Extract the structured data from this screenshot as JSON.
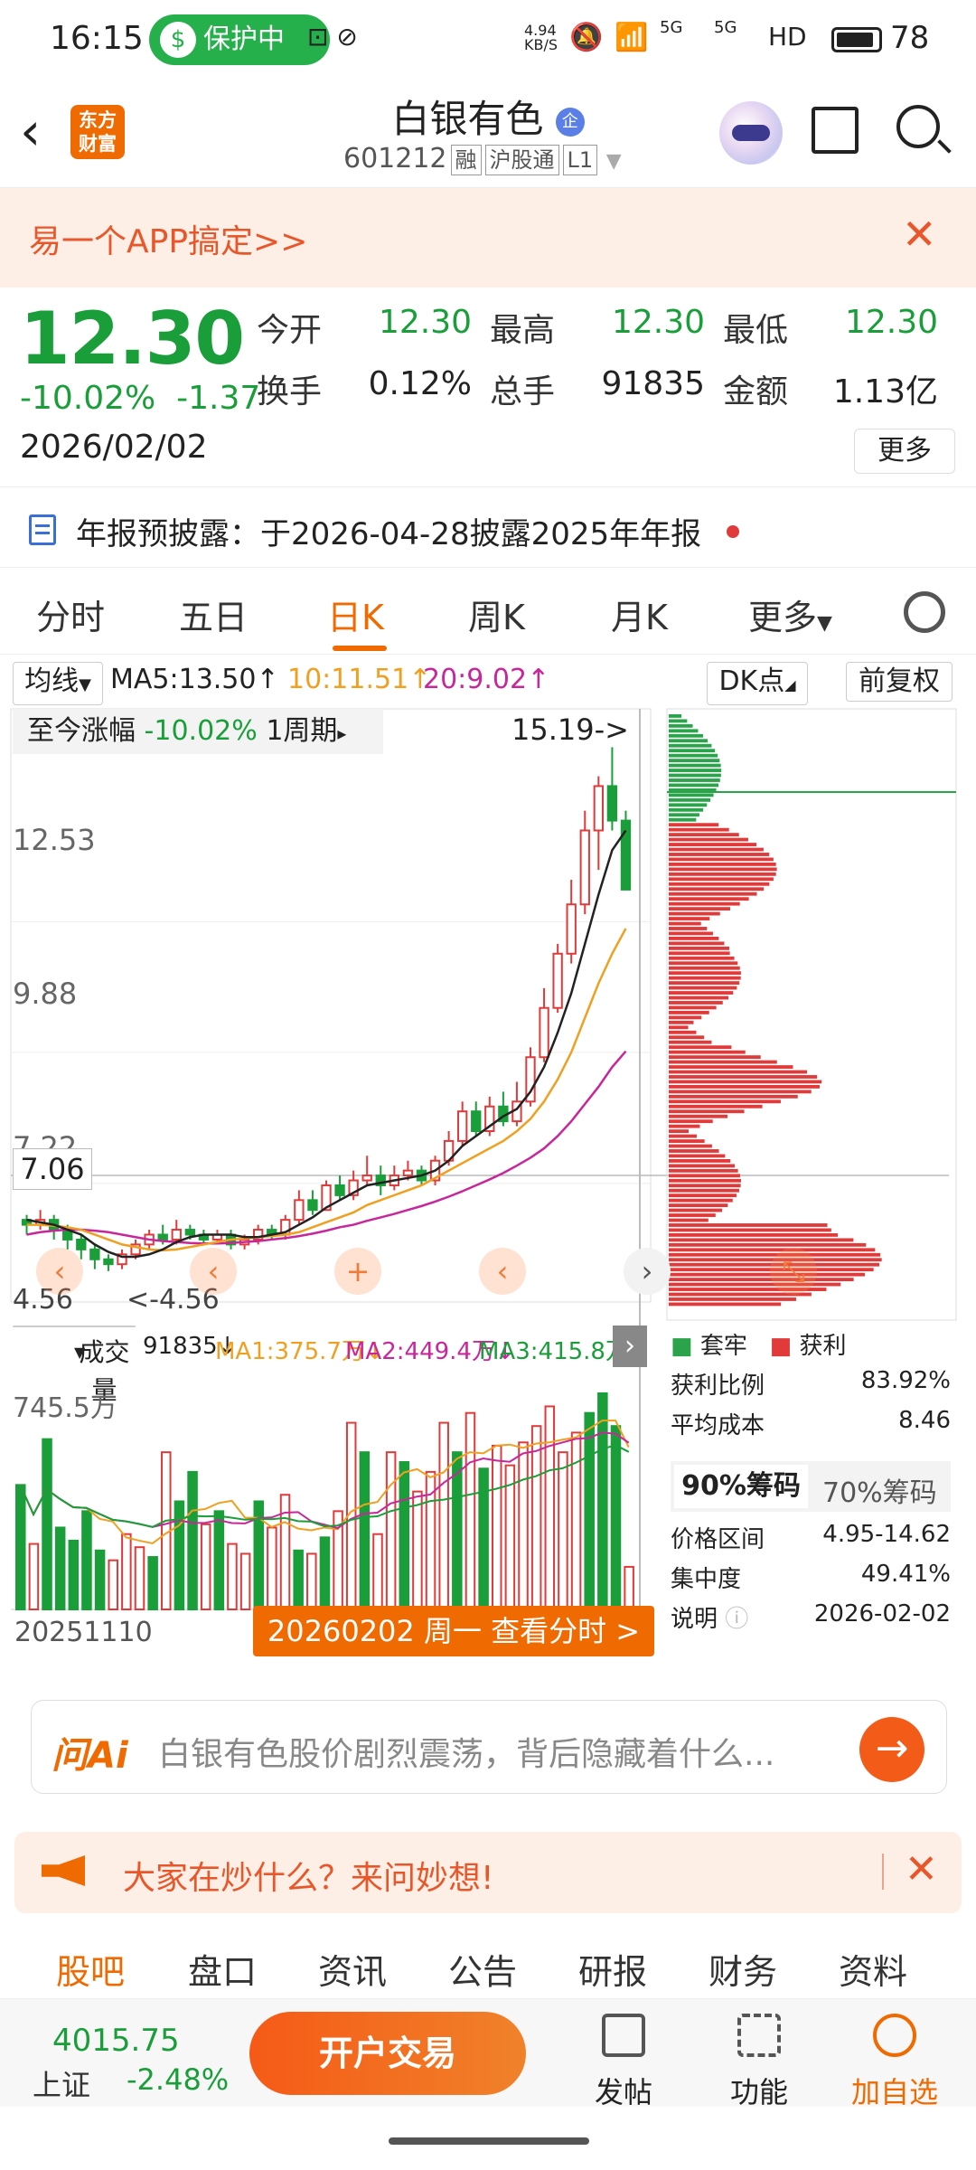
{
  "status_bar": {
    "time": "16:15",
    "protect_label": "保护中",
    "net_speed": "4.94 KB/S",
    "signal_5g_1": "5G",
    "signal_5g_2": "5G",
    "hd": "HD",
    "battery": "78"
  },
  "header": {
    "stock_name": "白银有色",
    "qi_badge": "企",
    "code": "601212",
    "tags": [
      "融",
      "沪股通",
      "L1"
    ],
    "logo_text": "东方财富"
  },
  "banner": {
    "text": "易一个APP搞定>>"
  },
  "quote": {
    "price": "12.30",
    "change_pct": "-10.02%",
    "change_abs": "-1.37",
    "date": "2026/02/02",
    "open_label": "今开",
    "open": "12.30",
    "high_label": "最高",
    "high": "12.30",
    "low_label": "最低",
    "low": "12.30",
    "turnover_label": "换手",
    "turnover": "0.12%",
    "volume_label": "总手",
    "volume": "91835",
    "amount_label": "金额",
    "amount": "1.13亿",
    "more_label": "更多"
  },
  "notice": {
    "text": "年报预披露：于2026-04-28披露2025年年报"
  },
  "tabs": [
    "分时",
    "五日",
    "日K",
    "周K",
    "月K",
    "更多"
  ],
  "active_tab": "日K",
  "ma_bar": {
    "selector": "均线",
    "ma5": "MA5:13.50↑",
    "ma10": "10:11.51↑",
    "ma20": "20:9.02↑",
    "dk": "DK点",
    "fq": "前复权"
  },
  "chart": {
    "range_label": "至今涨幅",
    "range_pct": "-10.02%",
    "period": "1周期",
    "high_marker": "15.19->",
    "low_marker": "4.56",
    "low_marker_left": "4.56",
    "y_labels": [
      "12.53",
      "9.88",
      "7.22"
    ],
    "current_price_box": "7.06"
  },
  "chart_data": {
    "type": "candlestick",
    "dates_start": "20251110",
    "dates_end": "20260202",
    "candles": [
      {
        "o": 5.6,
        "c": 5.5,
        "h": 5.7,
        "l": 5.3
      },
      {
        "o": 5.5,
        "c": 5.6,
        "h": 5.8,
        "l": 5.4
      },
      {
        "o": 5.6,
        "c": 5.4,
        "h": 5.7,
        "l": 5.2
      },
      {
        "o": 5.4,
        "c": 5.2,
        "h": 5.5,
        "l": 5.0
      },
      {
        "o": 5.2,
        "c": 5.0,
        "h": 5.3,
        "l": 4.8
      },
      {
        "o": 5.0,
        "c": 4.8,
        "h": 5.1,
        "l": 4.6
      },
      {
        "o": 4.8,
        "c": 4.7,
        "h": 4.9,
        "l": 4.56
      },
      {
        "o": 4.7,
        "c": 4.9,
        "h": 5.0,
        "l": 4.6
      },
      {
        "o": 4.9,
        "c": 5.1,
        "h": 5.2,
        "l": 4.8
      },
      {
        "o": 5.1,
        "c": 5.3,
        "h": 5.4,
        "l": 5.0
      },
      {
        "o": 5.3,
        "c": 5.2,
        "h": 5.5,
        "l": 5.1
      },
      {
        "o": 5.2,
        "c": 5.4,
        "h": 5.6,
        "l": 5.1
      },
      {
        "o": 5.4,
        "c": 5.3,
        "h": 5.5,
        "l": 5.2
      },
      {
        "o": 5.3,
        "c": 5.2,
        "h": 5.4,
        "l": 5.1
      },
      {
        "o": 5.2,
        "c": 5.3,
        "h": 5.4,
        "l": 5.1
      },
      {
        "o": 5.3,
        "c": 5.1,
        "h": 5.4,
        "l": 5.0
      },
      {
        "o": 5.1,
        "c": 5.2,
        "h": 5.3,
        "l": 5.0
      },
      {
        "o": 5.2,
        "c": 5.4,
        "h": 5.5,
        "l": 5.1
      },
      {
        "o": 5.4,
        "c": 5.3,
        "h": 5.5,
        "l": 5.2
      },
      {
        "o": 5.3,
        "c": 5.6,
        "h": 5.7,
        "l": 5.2
      },
      {
        "o": 5.6,
        "c": 6.0,
        "h": 6.2,
        "l": 5.5
      },
      {
        "o": 6.0,
        "c": 5.8,
        "h": 6.2,
        "l": 5.7
      },
      {
        "o": 5.8,
        "c": 6.3,
        "h": 6.4,
        "l": 5.8
      },
      {
        "o": 6.3,
        "c": 6.1,
        "h": 6.5,
        "l": 6.0
      },
      {
        "o": 6.1,
        "c": 6.4,
        "h": 6.6,
        "l": 6.0
      },
      {
        "o": 6.4,
        "c": 6.5,
        "h": 6.9,
        "l": 6.3
      },
      {
        "o": 6.5,
        "c": 6.3,
        "h": 6.7,
        "l": 6.1
      },
      {
        "o": 6.3,
        "c": 6.5,
        "h": 6.7,
        "l": 6.2
      },
      {
        "o": 6.5,
        "c": 6.6,
        "h": 6.8,
        "l": 6.4
      },
      {
        "o": 6.6,
        "c": 6.4,
        "h": 6.7,
        "l": 6.3
      },
      {
        "o": 6.4,
        "c": 6.8,
        "h": 6.9,
        "l": 6.3
      },
      {
        "o": 6.8,
        "c": 7.2,
        "h": 7.4,
        "l": 6.7
      },
      {
        "o": 7.2,
        "c": 7.8,
        "h": 8.0,
        "l": 7.1
      },
      {
        "o": 7.8,
        "c": 7.4,
        "h": 8.0,
        "l": 7.3
      },
      {
        "o": 7.4,
        "c": 7.9,
        "h": 8.1,
        "l": 7.3
      },
      {
        "o": 7.9,
        "c": 7.6,
        "h": 8.2,
        "l": 7.5
      },
      {
        "o": 7.6,
        "c": 8.0,
        "h": 8.4,
        "l": 7.5
      },
      {
        "o": 8.0,
        "c": 8.9,
        "h": 9.1,
        "l": 7.9
      },
      {
        "o": 8.9,
        "c": 9.9,
        "h": 10.3,
        "l": 8.8
      },
      {
        "o": 9.9,
        "c": 11.0,
        "h": 11.2,
        "l": 9.8
      },
      {
        "o": 11.0,
        "c": 12.0,
        "h": 12.5,
        "l": 10.8
      },
      {
        "o": 12.0,
        "c": 13.5,
        "h": 13.9,
        "l": 11.8
      },
      {
        "o": 13.5,
        "c": 14.4,
        "h": 14.6,
        "l": 12.7
      },
      {
        "o": 14.4,
        "c": 13.7,
        "h": 15.19,
        "l": 13.5
      },
      {
        "o": 13.7,
        "c": 12.3,
        "h": 13.9,
        "l": 12.3
      }
    ],
    "ma5": [
      5.6,
      5.55,
      5.5,
      5.4,
      5.3,
      5.1,
      4.95,
      4.85,
      4.85,
      4.9,
      5.0,
      5.15,
      5.25,
      5.3,
      5.3,
      5.3,
      5.25,
      5.25,
      5.3,
      5.35,
      5.5,
      5.65,
      5.85,
      6.0,
      6.15,
      6.3,
      6.35,
      6.4,
      6.45,
      6.5,
      6.6,
      6.8,
      7.1,
      7.3,
      7.5,
      7.7,
      7.85,
      8.2,
      8.7,
      9.4,
      10.2,
      11.2,
      12.2,
      13.1,
      13.5
    ],
    "ma10": [
      5.5,
      5.5,
      5.48,
      5.45,
      5.4,
      5.3,
      5.2,
      5.1,
      5.05,
      5.0,
      4.98,
      5.0,
      5.05,
      5.1,
      5.15,
      5.2,
      5.22,
      5.25,
      5.27,
      5.3,
      5.35,
      5.45,
      5.55,
      5.65,
      5.75,
      5.9,
      6.0,
      6.1,
      6.2,
      6.3,
      6.45,
      6.6,
      6.75,
      6.9,
      7.05,
      7.2,
      7.4,
      7.65,
      8.0,
      8.45,
      9.0,
      9.7,
      10.4,
      11.0,
      11.51
    ],
    "ma20": [
      5.3,
      5.35,
      5.38,
      5.4,
      5.4,
      5.38,
      5.35,
      5.3,
      5.25,
      5.2,
      5.17,
      5.15,
      5.13,
      5.12,
      5.12,
      5.13,
      5.15,
      5.17,
      5.2,
      5.23,
      5.27,
      5.32,
      5.38,
      5.45,
      5.5,
      5.58,
      5.65,
      5.72,
      5.8,
      5.88,
      5.97,
      6.07,
      6.18,
      6.3,
      6.42,
      6.55,
      6.7,
      6.86,
      7.05,
      7.3,
      7.6,
      7.95,
      8.3,
      8.7,
      9.02
    ],
    "volume": {
      "label": "成交量",
      "latest": "91835↓",
      "ma1": "MA1:375.7万↓",
      "ma2": "MA2:449.4万↓",
      "ma3": "MA3:415.8万↓",
      "max_label": "745.5万",
      "values": [
        380,
        200,
        520,
        250,
        210,
        300,
        180,
        150,
        230,
        190,
        160,
        480,
        330,
        420,
        260,
        300,
        200,
        170,
        330,
        250,
        350,
        180,
        170,
        220,
        300,
        570,
        480,
        230,
        480,
        450,
        360,
        420,
        570,
        480,
        600,
        430,
        500,
        440,
        510,
        560,
        620,
        480,
        540,
        600,
        660,
        560,
        130
      ]
    },
    "chip_distribution": {
      "profit_color": "#e03a3a",
      "trapped_color": "#2aa34a"
    }
  },
  "chips_panel": {
    "legend_trapped": "套牢",
    "legend_profit": "获利",
    "profit_ratio_label": "获利比例",
    "profit_ratio": "83.92%",
    "avg_cost_label": "平均成本",
    "avg_cost": "8.46",
    "tab_90": "90%筹码",
    "tab_70": "70%筹码",
    "price_range_label": "价格区间",
    "price_range": "4.95-14.62",
    "concentration_label": "集中度",
    "concentration": "49.41%",
    "desc_label": "说明",
    "desc_date": "2026-02-02"
  },
  "volume_footer": {
    "start_date": "20251110",
    "fenshi_button": "20260202 周一 查看分时 >"
  },
  "ai_box": {
    "logo": "问Ai",
    "placeholder": "白银有色股价剧烈震荡，背后隐藏着什么..."
  },
  "hot_banner": {
    "text": "大家在炒什么？来问妙想!"
  },
  "sub_tabs": [
    "股吧",
    "盘口",
    "资讯",
    "公告",
    "研报",
    "财务",
    "资料"
  ],
  "active_sub_tab": "股吧",
  "bottom_bar": {
    "index_value": "4015.75",
    "index_name": "上证",
    "index_pct": "-2.48%",
    "trade_button": "开户交易",
    "post": "发帖",
    "func": "功能",
    "add_fav": "加自选"
  },
  "colors": {
    "accent": "#ef6a00",
    "up": "#e03a3a",
    "down": "#1a9e3a",
    "ma5": "#222222",
    "ma10": "#f0a020",
    "ma20": "#c8279a"
  }
}
